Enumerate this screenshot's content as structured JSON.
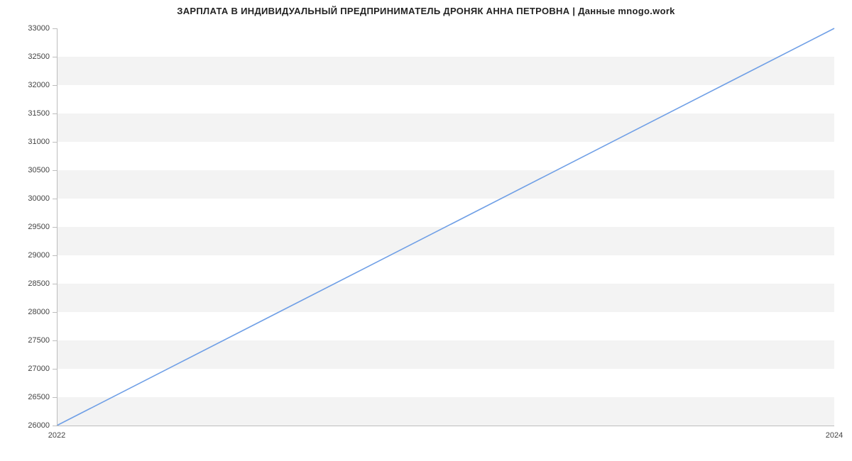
{
  "chart_data": {
    "type": "line",
    "title": "ЗАРПЛАТА В ИНДИВИДУАЛЬНЫЙ ПРЕДПРИНИМАТЕЛЬ ДРОНЯК АННА ПЕТРОВНА | Данные mnogo.work",
    "xlabel": "",
    "ylabel": "",
    "x": [
      2022,
      2024
    ],
    "y": [
      26000,
      33000
    ],
    "x_ticks": [
      2022,
      2024
    ],
    "y_ticks": [
      26000,
      26500,
      27000,
      27500,
      28000,
      28500,
      29000,
      29500,
      30000,
      30500,
      31000,
      31500,
      32000,
      32500,
      33000
    ],
    "xlim": [
      2022,
      2024
    ],
    "ylim": [
      26000,
      33000
    ],
    "line_color": "#6f9fe6",
    "band_color": "#f3f3f3",
    "axis_color": "#bdbdbd"
  }
}
